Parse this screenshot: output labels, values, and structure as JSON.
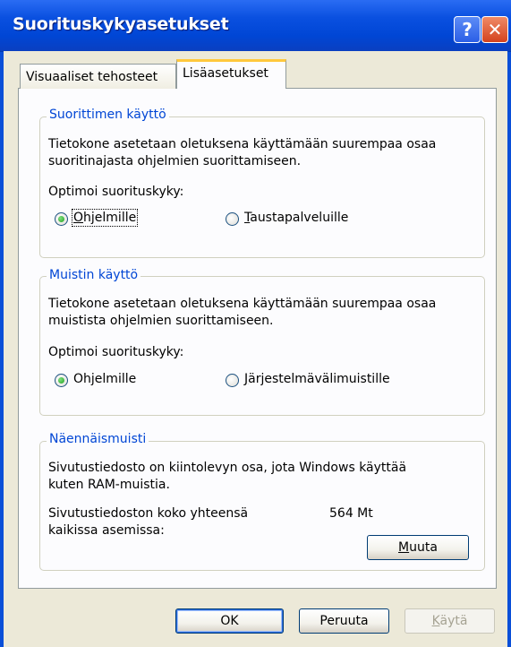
{
  "window": {
    "title": "Suorituskykyasetukset",
    "help_label": "?",
    "close_label": "✕"
  },
  "tabs": [
    {
      "label": "Visuaaliset tehosteet",
      "selected": false
    },
    {
      "label": "Lisäasetukset",
      "selected": true
    }
  ],
  "processor": {
    "legend": "Suorittimen käyttö",
    "description_line1": "Tietokone asetetaan oletuksena käyttämään suurempaa osaa",
    "description_line2": "suoritinajasta ohjelmien suorittamiseen.",
    "optimize_label": "Optimoi suorituskyky:",
    "option_programs": {
      "mnemonic": "O",
      "rest": "hjelmille",
      "selected": true
    },
    "option_background": {
      "mnemonic": "T",
      "rest": "austapalveluille",
      "selected": false
    }
  },
  "memory": {
    "legend": "Muistin käyttö",
    "description_line1": "Tietokone asetetaan oletuksena käyttämään suurempaa osaa",
    "description_line2": "muistista ohjelmien suorittamiseen.",
    "optimize_label": "Optimoi suorituskyky:",
    "option_programs": {
      "pre": "Oh",
      "mnemonic": "j",
      "rest": "elmille",
      "selected": true
    },
    "option_cache": {
      "mnemonic": "J",
      "rest": "ärjestelmävälimuistille",
      "selected": false
    }
  },
  "virtual_memory": {
    "legend": "Näennäismuisti",
    "description_line1": "Sivutustiedosto on kiintolevyn osa, jota Windows käyttää",
    "description_line2": "kuten RAM-muistia.",
    "size_label_line1": "Sivutustiedoston koko yhteensä",
    "size_label_line2": "kaikissa asemissa:",
    "size_value": "564 Mt",
    "change_button": {
      "mnemonic": "M",
      "rest": "uuta"
    }
  },
  "buttons": {
    "ok": "OK",
    "cancel": "Peruuta",
    "apply": {
      "mnemonic": "K",
      "rest": "äytä",
      "enabled": false
    }
  }
}
